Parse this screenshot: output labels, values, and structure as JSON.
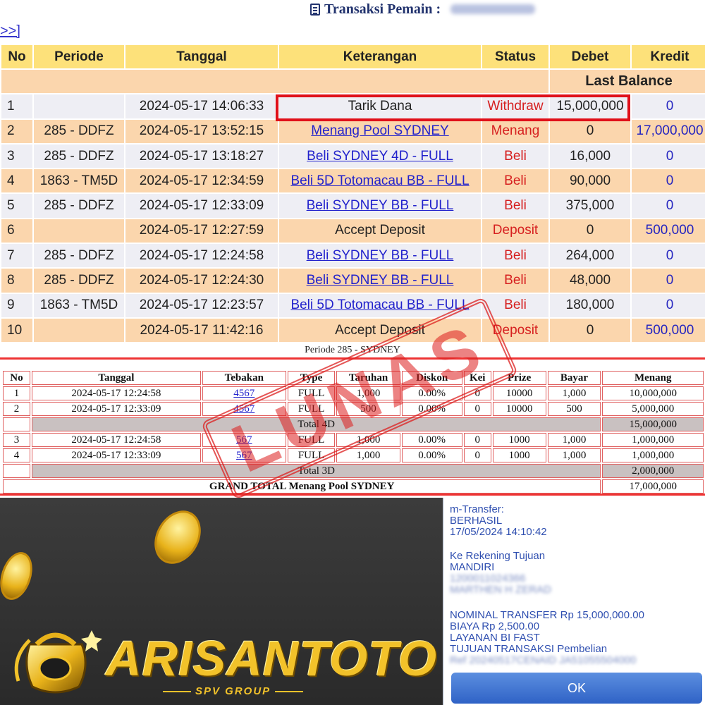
{
  "header": {
    "title": "Transaksi Pemain :",
    "player_name": "martin1968",
    "nav_link": ">>]"
  },
  "transactions": {
    "columns": [
      "No",
      "Periode",
      "Tanggal",
      "Keterangan",
      "Status",
      "Debet",
      "Kredit"
    ],
    "last_balance_label": "Last Balance",
    "rows": [
      {
        "no": "1",
        "periode": "",
        "tanggal": "2024-05-17 14:06:33",
        "keterangan": "Tarik Dana",
        "is_link": false,
        "status": "Withdraw",
        "debet": "15,000,000",
        "kredit": "0"
      },
      {
        "no": "2",
        "periode": "285 - DDFZ",
        "tanggal": "2024-05-17 13:52:15",
        "keterangan": "Menang Pool SYDNEY",
        "is_link": true,
        "status": "Menang",
        "debet": "0",
        "kredit": "17,000,000"
      },
      {
        "no": "3",
        "periode": "285 - DDFZ",
        "tanggal": "2024-05-17 13:18:27",
        "keterangan": "Beli SYDNEY 4D - FULL",
        "is_link": true,
        "status": "Beli",
        "debet": "16,000",
        "kredit": "0"
      },
      {
        "no": "4",
        "periode": "1863 - TM5D",
        "tanggal": "2024-05-17 12:34:59",
        "keterangan": "Beli 5D Totomacau BB - FULL",
        "is_link": true,
        "status": "Beli",
        "debet": "90,000",
        "kredit": "0"
      },
      {
        "no": "5",
        "periode": "285 - DDFZ",
        "tanggal": "2024-05-17 12:33:09",
        "keterangan": "Beli SYDNEY BB - FULL",
        "is_link": true,
        "status": "Beli",
        "debet": "375,000",
        "kredit": "0"
      },
      {
        "no": "6",
        "periode": "",
        "tanggal": "2024-05-17 12:27:59",
        "keterangan": "Accept Deposit",
        "is_link": false,
        "status": "Deposit",
        "debet": "0",
        "kredit": "500,000"
      },
      {
        "no": "7",
        "periode": "285 - DDFZ",
        "tanggal": "2024-05-17 12:24:58",
        "keterangan": "Beli SYDNEY BB - FULL",
        "is_link": true,
        "status": "Beli",
        "debet": "264,000",
        "kredit": "0"
      },
      {
        "no": "8",
        "periode": "285 - DDFZ",
        "tanggal": "2024-05-17 12:24:30",
        "keterangan": "Beli SYDNEY BB - FULL",
        "is_link": true,
        "status": "Beli",
        "debet": "48,000",
        "kredit": "0"
      },
      {
        "no": "9",
        "periode": "1863 - TM5D",
        "tanggal": "2024-05-17 12:23:57",
        "keterangan": "Beli 5D Totomacau BB - FULL",
        "is_link": true,
        "status": "Beli",
        "debet": "180,000",
        "kredit": "0"
      },
      {
        "no": "10",
        "periode": "",
        "tanggal": "2024-05-17 11:42:16",
        "keterangan": "Accept Deposit",
        "is_link": false,
        "status": "Deposit",
        "debet": "0",
        "kredit": "500,000"
      }
    ]
  },
  "detail": {
    "caption": "Periode 285 - SYDNEY",
    "columns": [
      "No",
      "Tanggal",
      "Tebakan",
      "Type",
      "Taruhan",
      "Diskon",
      "Kei",
      "Prize",
      "Bayar",
      "Menang"
    ],
    "group_4d": [
      {
        "no": "1",
        "tanggal": "2024-05-17 12:24:58",
        "tebakan": "4567",
        "type": "FULL",
        "taruhan": "1,000",
        "diskon": "0.00%",
        "kei": "0",
        "prize": "10000",
        "bayar": "1,000",
        "menang": "10,000,000"
      },
      {
        "no": "2",
        "tanggal": "2024-05-17 12:33:09",
        "tebakan": "4567",
        "type": "FULL",
        "taruhan": "500",
        "diskon": "0.00%",
        "kei": "0",
        "prize": "10000",
        "bayar": "500",
        "menang": "5,000,000"
      }
    ],
    "total_4d_label": "Total 4D",
    "total_4d_value": "15,000,000",
    "group_3d": [
      {
        "no": "3",
        "tanggal": "2024-05-17 12:24:58",
        "tebakan": "567",
        "type": "FULL",
        "taruhan": "1,000",
        "diskon": "0.00%",
        "kei": "0",
        "prize": "1000",
        "bayar": "1,000",
        "menang": "1,000,000"
      },
      {
        "no": "4",
        "tanggal": "2024-05-17 12:33:09",
        "tebakan": "567",
        "type": "FULL",
        "taruhan": "1,000",
        "diskon": "0.00%",
        "kei": "0",
        "prize": "1000",
        "bayar": "1,000",
        "menang": "1,000,000"
      }
    ],
    "total_3d_label": "Total 3D",
    "total_3d_value": "2,000,000",
    "grand_total_label": "GRAND TOTAL  Menang Pool SYDNEY",
    "grand_total_value": "17,000,000"
  },
  "stamp": {
    "text": "LUNAS",
    "color": "#dc1e1e"
  },
  "promo": {
    "brand_name": "ARISANTOTO",
    "brand_tag": "SPV GROUP",
    "logo_icon": "golden-bag-logo-icon",
    "coin_icon": "gold-coin-icon"
  },
  "receipt": {
    "line1": "m-Transfer:",
    "line2": "BERHASIL",
    "line3": "17/05/2024 14:10:42",
    "line4": "Ke Rekening Tujuan",
    "line5": "MANDIRI",
    "account_blurred": "1200011024366",
    "name_blurred": "MARTHEN H ZERAD",
    "line6": "NOMINAL TRANSFER Rp 15,000,000.00",
    "line7": "BIAYA Rp 2,500.00",
    "line8": "LAYANAN BI FAST",
    "line9": "TUJUAN TRANSAKSI Pembelian",
    "ref_blurred": "Ref 20240517CENAID JA51055504000",
    "ok_label": "OK"
  },
  "colors": {
    "header_bg": "#fde17a",
    "row_odd": "#eeeef4",
    "row_even": "#fbd6ad",
    "status_red": "#d61f1f",
    "kredit_blue": "#2525c0",
    "highlight_red": "#e0101a",
    "brand_gold": "#f2c22a"
  }
}
